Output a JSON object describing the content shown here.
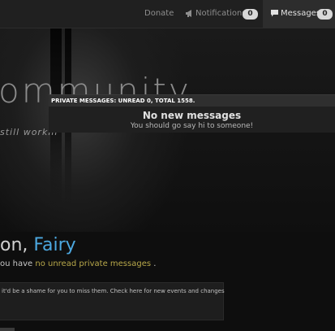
{
  "nav": {
    "donate": "Donate",
    "notifications_label": "Notifications",
    "notifications_count": "0",
    "notifications_icon": "megaphone-icon",
    "messages_label": "Messages",
    "messages_count": "0",
    "messages_icon": "speech-bubble-icon"
  },
  "hero": {
    "title": "ommunity",
    "subtitle": "still workin"
  },
  "dropdown": {
    "header_prefix": "PRIVATE MESSAGES",
    "header_stats": ": UNREAD 0, TOTAL 1558.",
    "title": "No new messages",
    "subtitle": "You should go say hi to someone!"
  },
  "welcome": {
    "greeting": "on, ",
    "username": "Fairy",
    "unread_prefix": "ou have ",
    "unread_link": "no unread private messages",
    "unread_suffix": " ."
  },
  "notice": {
    "text": "it'd be a shame for you to miss them. Check here for new events and changes"
  },
  "colors": {
    "username": "#4ca8e0",
    "highlight": "#b8a84a",
    "topbar": "#202020"
  }
}
